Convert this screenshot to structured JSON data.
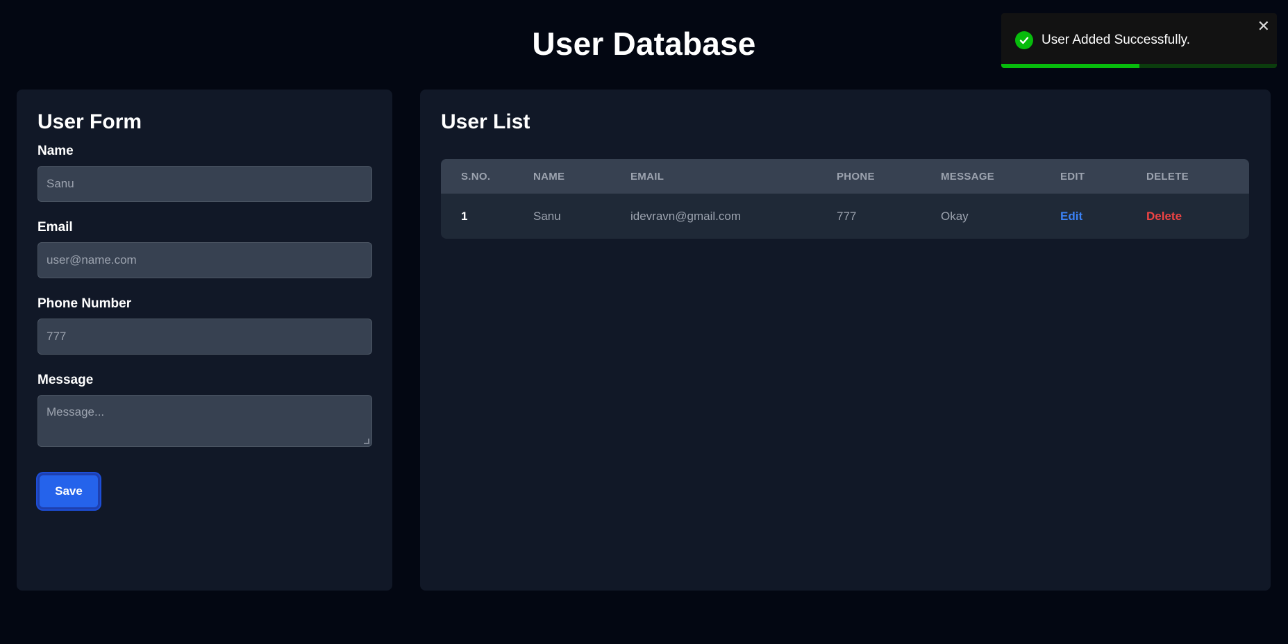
{
  "header": {
    "title": "User Database"
  },
  "form": {
    "title": "User Form",
    "name_label": "Name",
    "name_value": "Sanu",
    "email_label": "Email",
    "email_placeholder": "user@name.com",
    "phone_label": "Phone Number",
    "phone_value": "777",
    "message_label": "Message",
    "message_placeholder": "Message...",
    "save_label": "Save"
  },
  "list": {
    "title": "User List",
    "columns": [
      "S.No.",
      "Name",
      "Email",
      "Phone",
      "Message",
      "Edit",
      "Delete"
    ],
    "rows": [
      {
        "sno": "1",
        "name": "Sanu",
        "email": "idevravn@gmail.com",
        "phone": "777",
        "message": "Okay",
        "edit": "Edit",
        "delete": "Delete"
      }
    ]
  },
  "toast": {
    "message": "User Added Successfully.",
    "close_glyph": "✕",
    "progress": 0.5,
    "success_color": "#07bc0c"
  },
  "colors": {
    "accent": "#2563eb",
    "edit": "#3b82f6",
    "delete": "#ef4444",
    "background": "#030712",
    "card": "#111827"
  }
}
